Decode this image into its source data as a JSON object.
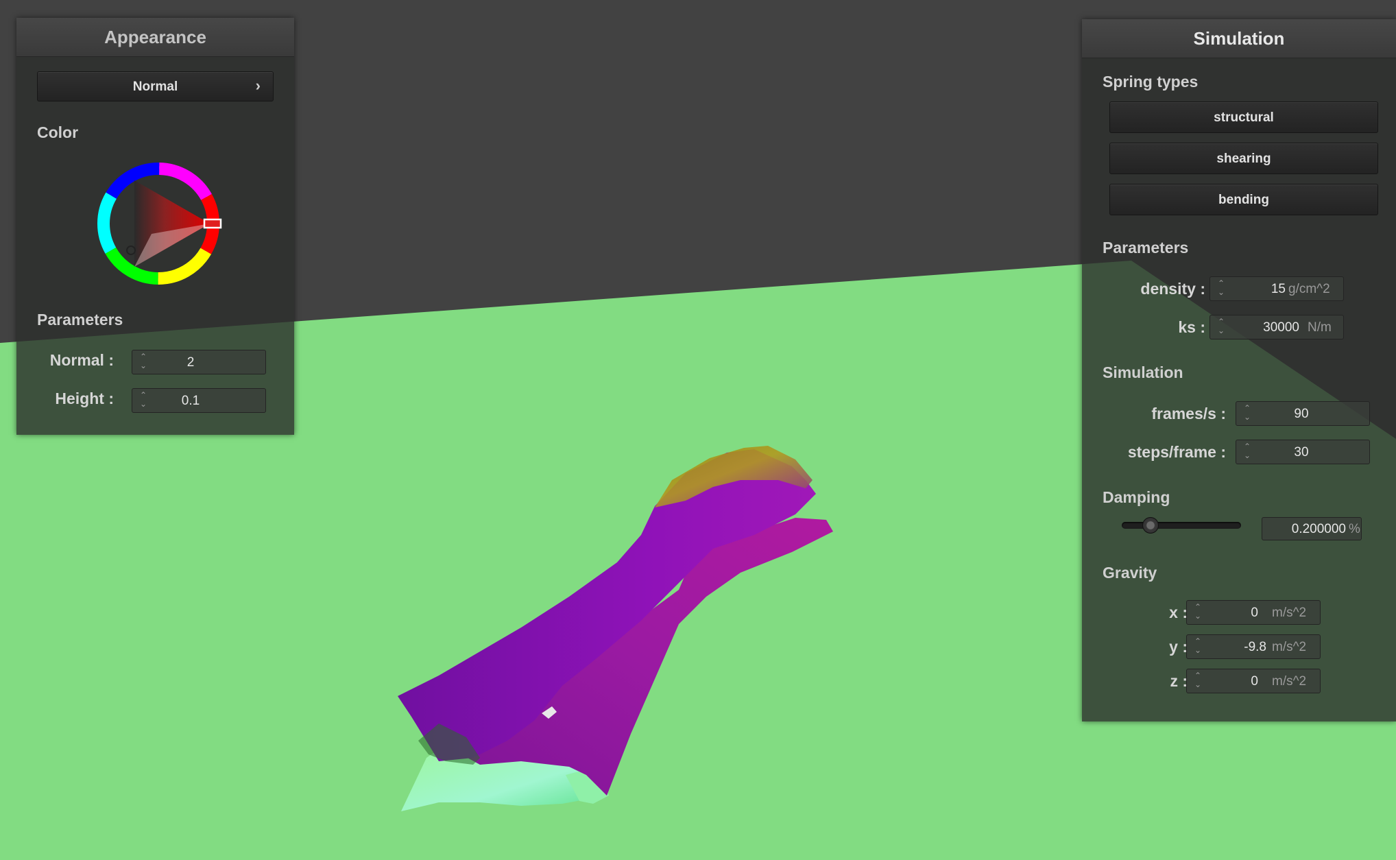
{
  "appearance": {
    "title": "Appearance",
    "mode_button": {
      "label": "Normal",
      "arrow": "›"
    },
    "color_label": "Color",
    "color": {
      "selected_hue": "#ff0000"
    },
    "parameters_label": "Parameters",
    "normal": {
      "label": "Normal :",
      "value": "2"
    },
    "height": {
      "label": "Height :",
      "value": "0.1"
    }
  },
  "simulation": {
    "title": "Simulation",
    "spring_types_label": "Spring types",
    "spring_types": [
      "structural",
      "shearing",
      "bending"
    ],
    "parameters_label": "Parameters",
    "density": {
      "label": "density :",
      "value": "15",
      "unit": "g/cm^2"
    },
    "ks": {
      "label": "ks :",
      "value": "30000",
      "unit": "N/m"
    },
    "simulation_label": "Simulation",
    "fps": {
      "label": "frames/s :",
      "value": "90"
    },
    "steps": {
      "label": "steps/frame :",
      "value": "30"
    },
    "damping_label": "Damping",
    "damping": {
      "value": "0.200000",
      "unit": "%",
      "slider_fraction": 0.2
    },
    "gravity_label": "Gravity",
    "gravity": [
      {
        "label": "x :",
        "value": "0",
        "unit": "m/s^2"
      },
      {
        "label": "y :",
        "value": "-9.8",
        "unit": "m/s^2"
      },
      {
        "label": "z :",
        "value": "0",
        "unit": "m/s^2"
      }
    ]
  },
  "colors": {
    "background": "#424242",
    "ground": "#82dc82",
    "cloth": "#8a10a8"
  },
  "icons": {
    "dropdown_arrow": "chevron-right-icon",
    "spinner": "spinner-arrows-icon"
  }
}
